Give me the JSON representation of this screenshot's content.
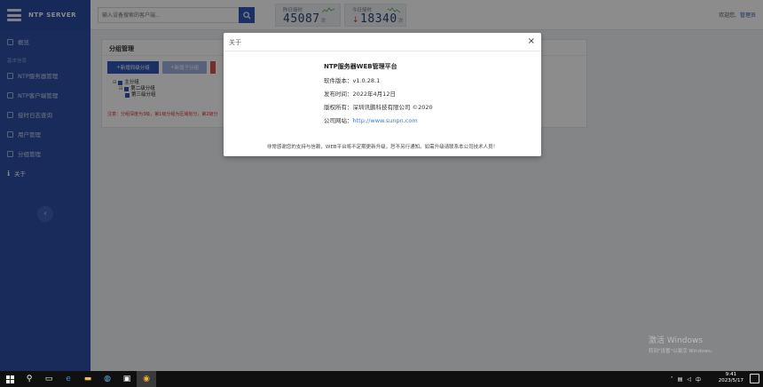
{
  "sidebar": {
    "brand": "NTP SERVER",
    "items_top": [
      {
        "label": "概览"
      }
    ],
    "section_label": "基本信息",
    "items": [
      {
        "label": "NTP服务器管理"
      },
      {
        "label": "NTP客户端管理"
      },
      {
        "label": "授时日志查询"
      },
      {
        "label": "用户管理"
      },
      {
        "label": "分组管理"
      },
      {
        "label": "关于"
      }
    ],
    "collapse_icon": "chevron-left"
  },
  "header": {
    "search_placeholder": "输入设备搜索的客户端...",
    "stat_yesterday": {
      "label": "昨日授时",
      "value": "45087",
      "unit": "次"
    },
    "stat_today": {
      "label": "今日授时",
      "value": "18340",
      "unit": "次"
    },
    "welcome": "欢迎您,",
    "user": "管理员"
  },
  "panel": {
    "title": "分组管理",
    "btn_add_root": "新增同级分组",
    "btn_add_child": "新增子分组",
    "tree": [
      "主分组",
      "第二级分组",
      "第三级分组"
    ],
    "note": "注意：分组深度为3级，第1级分组为区域划分，第2级分"
  },
  "modal": {
    "title": "关于",
    "app_name": "NTP服务器WEB管理平台",
    "version_label": "软件版本：",
    "version": "v1.0.28.1",
    "release_label": "发布时间：",
    "release": "2022年4月12日",
    "copyright_label": "版权所有：",
    "copyright": "深圳讯鹏科技有限公司 ©2020",
    "website_label": "公司网站：",
    "website": "http://www.sunpn.com",
    "footer": "非常感谢您的支持与信赖，WEB平台将不定期更新升级，恕不另行通知。如需升级请联系本公司技术人员！"
  },
  "watermark": {
    "line1": "激活 Windows",
    "line2": "转到\"设置\"以激活 Windows。"
  },
  "taskbar": {
    "time": "9:41",
    "date": "2023/5/17"
  }
}
